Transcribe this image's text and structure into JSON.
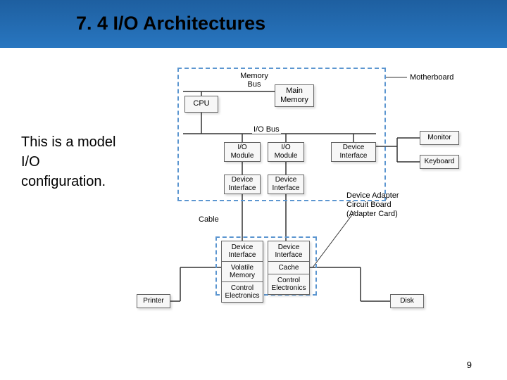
{
  "title": "7. 4 I/O Architectures",
  "side_text": "This is a model I/O configuration.",
  "page_number": "9",
  "diagram": {
    "boxes": {
      "cpu": "CPU",
      "main_memory": "Main\nMemory",
      "io_module_1": "I/O\nModule",
      "io_module_2": "I/O\nModule",
      "dev_if_1": "Device\nInterface",
      "dev_if_2": "Device\nInterface",
      "dev_if_right": "Device\nInterface",
      "monitor": "Monitor",
      "keyboard": "Keyboard",
      "printer": "Printer",
      "disk": "Disk"
    },
    "stacks": {
      "left": [
        "Device\nInterface",
        "Volatile\nMemory",
        "Control\nElectronics"
      ],
      "right": [
        "Device\nInterface",
        "Cache",
        "Control\nElectronics"
      ]
    },
    "labels": {
      "memory_bus": "Memory\nBus",
      "io_bus": "I/O Bus",
      "motherboard": "Motherboard",
      "cable": "Cable",
      "adapter_card": "Device Adapter\nCircuit Board\n(Adapter Card)"
    }
  }
}
